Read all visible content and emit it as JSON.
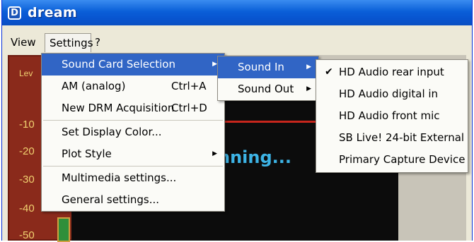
{
  "window": {
    "title": "dream",
    "icon_letter": "D"
  },
  "menubar": {
    "items": [
      {
        "label": "View"
      },
      {
        "label": "Settings"
      },
      {
        "label": "?"
      }
    ]
  },
  "background": {
    "meter_labels": [
      "Lev",
      "-10",
      "-20",
      "-30",
      "-40",
      "-50"
    ],
    "status_text": "nning..."
  },
  "settings_menu": {
    "items": [
      {
        "label": "Sound Card Selection",
        "shortcut": "",
        "submenu": true,
        "highlighted": true
      },
      {
        "label": "AM (analog)",
        "shortcut": "Ctrl+A"
      },
      {
        "label": "New DRM Acquisition",
        "shortcut": "Ctrl+D"
      },
      {
        "label": "Set Display Color...",
        "shortcut": ""
      },
      {
        "label": "Plot Style",
        "shortcut": "",
        "submenu": true
      },
      {
        "label": "Multimedia settings...",
        "shortcut": ""
      },
      {
        "label": "General settings...",
        "shortcut": ""
      }
    ]
  },
  "sound_card_menu": {
    "items": [
      {
        "label": "Sound In",
        "submenu": true,
        "highlighted": true
      },
      {
        "label": "Sound Out",
        "submenu": true
      }
    ]
  },
  "sound_in_menu": {
    "items": [
      {
        "label": "HD Audio rear input",
        "checked": true
      },
      {
        "label": "HD Audio digital in",
        "checked": false
      },
      {
        "label": "HD Audio front mic",
        "checked": false
      },
      {
        "label": "SB Live! 24-bit External",
        "checked": false
      },
      {
        "label": "Primary Capture Device",
        "checked": false
      }
    ]
  },
  "colors": {
    "titlebar": "#0a5fd8",
    "highlight": "#3165c5",
    "menu_bg": "#fbfbf7",
    "status_text": "#3db4e6"
  }
}
